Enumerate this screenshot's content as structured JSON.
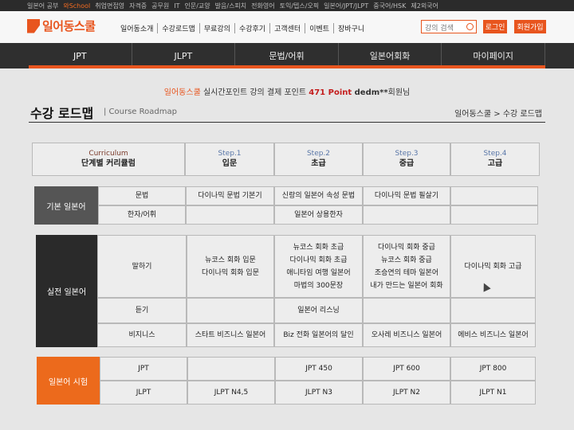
{
  "topbar": {
    "items": [
      "일본어 공부",
      "",
      "취업면접영",
      "자격증",
      "공무원",
      "IT",
      "인문/교양",
      "발음/스피치",
      "전화영어",
      "토익/텝스/오픽",
      "일본어/JPT/JLPT",
      "중국어/HSK",
      "제2외국어"
    ],
    "highlight": "와School"
  },
  "header": {
    "logo_text": "일어동스쿨",
    "gnb": [
      "일어동소개",
      "수강로드맵",
      "무료강의",
      "수강후기",
      "고객센터",
      "이벤트",
      "장바구니"
    ],
    "search_placeholder": "강의 검색",
    "login_label": "로그인",
    "join_label": "회원가입"
  },
  "nav": {
    "tabs": [
      "JPT",
      "JLPT",
      "문법/어휘",
      "일본어회화",
      "마이페이지"
    ]
  },
  "point_line": {
    "brand": "일어동스쿨",
    "text1": " 실시간포인트 강의 결제 포인트 ",
    "points": "471 Point",
    "user": " dedm**",
    "suffix": "회원님"
  },
  "page": {
    "title": "수강 로드맵",
    "subtitle": "| Course Roadmap",
    "breadcrumb": "일어동스쿨 > 수강 로드맵"
  },
  "table": {
    "header": {
      "curriculum_en": "Curriculum",
      "curriculum_ko": "단계별 커리큘럼",
      "steps": [
        {
          "en": "Step.1",
          "ko": "입문"
        },
        {
          "en": "Step.2",
          "ko": "초급"
        },
        {
          "en": "Step.3",
          "ko": "중급"
        },
        {
          "en": "Step.4",
          "ko": "고급"
        }
      ]
    },
    "categories": [
      "기본 일본어",
      "실전 일본어",
      "일본어 시험"
    ],
    "rows": {
      "grammar": {
        "label": "문법",
        "cells": [
          "다이나믹 문법 기본기",
          "신랑의 일본어 속성 문법",
          "다이나믹 문법 필살기",
          ""
        ]
      },
      "kanji": {
        "label": "한자/어휘",
        "cells": [
          "",
          "일본어 상용한자",
          "",
          ""
        ]
      },
      "speaking": {
        "label": "말하기",
        "cells": [
          "뉴코스 회화 입문\n다이나믹 회화 입문",
          "뉴코스 회화 초급\n다이나믹 회화 초급\n애니타임 여행 일본어\n마법의 300문장",
          "다이나믹 회화 중급\n뉴코스 회화 중급\n조승연의 테마 일본어\n내가 만드는 일본어 회화",
          "다이나믹 회화 고급"
        ]
      },
      "listening": {
        "label": "듣기",
        "cells": [
          "",
          "일본어 리스닝",
          "",
          ""
        ]
      },
      "business": {
        "label": "비지니스",
        "cells": [
          "스타트 비즈니스 일본어",
          "Biz 전화 일본어의 달인",
          "오사레 비즈니스 일본어",
          "에비스 비즈니스 일본어"
        ]
      },
      "jpt": {
        "label": "JPT",
        "cells": [
          "",
          "JPT 450",
          "JPT 600",
          "JPT 800"
        ]
      },
      "jlpt": {
        "label": "JLPT",
        "cells": [
          "JLPT N4,5",
          "JLPT N3",
          "JLPT N2",
          "JLPT N1"
        ]
      }
    }
  },
  "colors": {
    "accent": "#e8551e",
    "cat_basic": "#555555",
    "cat_practical": "#2a2a2a",
    "cat_exam": "#ec6a1c"
  }
}
